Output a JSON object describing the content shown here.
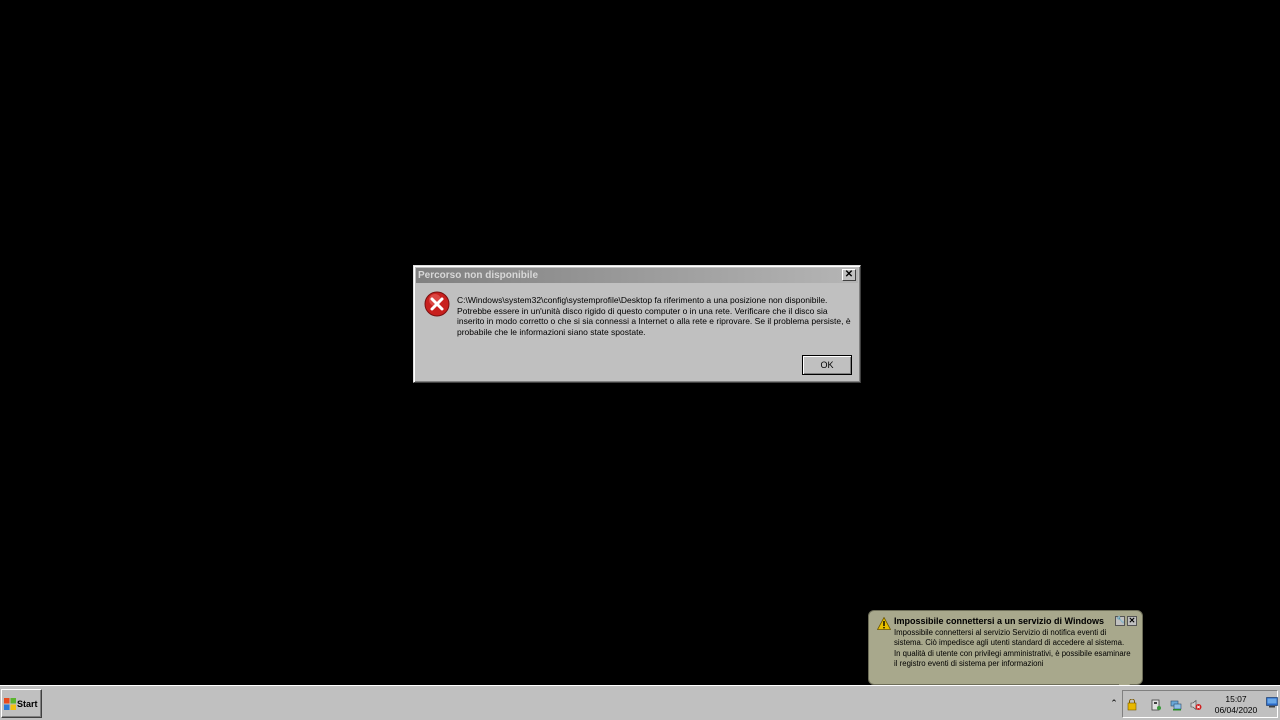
{
  "dialog": {
    "title": "Percorso non disponibile",
    "close_label": "✕",
    "message_line1": "C:\\Windows\\system32\\config\\systemprofile\\Desktop fa riferimento a una posizione non disponibile.",
    "message_line2": "Potrebbe essere in un'unità disco rigido di questo computer o in una rete. Verificare che il disco sia inserito in modo corretto o che si sia connessi a Internet o alla rete e riprovare. Se il problema persiste, è probabile che le informazioni siano state spostate.",
    "ok_label": "OK",
    "icon": "error-icon"
  },
  "balloon": {
    "title": "Impossibile connettersi a un servizio di Windows",
    "body_line1": "Impossibile connettersi al servizio Servizio di notifica eventi di sistema. Ciò impedisce agli utenti standard di accedere al sistema.",
    "body_line2": "In qualità di utente con privilegi amministrativi, è possibile esaminare il registro eventi di sistema per informazioni",
    "icon": "warning-icon",
    "close_label": "✕"
  },
  "taskbar": {
    "start_label": "Start",
    "tray_expand_label": "⌃",
    "clock_time": "15:07",
    "clock_date": "06/04/2020",
    "tray_icons": [
      "security-alert-icon",
      "usb-device-icon",
      "network-icon",
      "volume-muted-icon"
    ]
  },
  "colors": {
    "desktop": "#000000",
    "dialog_face": "#c0c0c0",
    "balloon": "#a8a88c",
    "error_red": "#c8201e",
    "warning_yellow": "#e8c000"
  }
}
